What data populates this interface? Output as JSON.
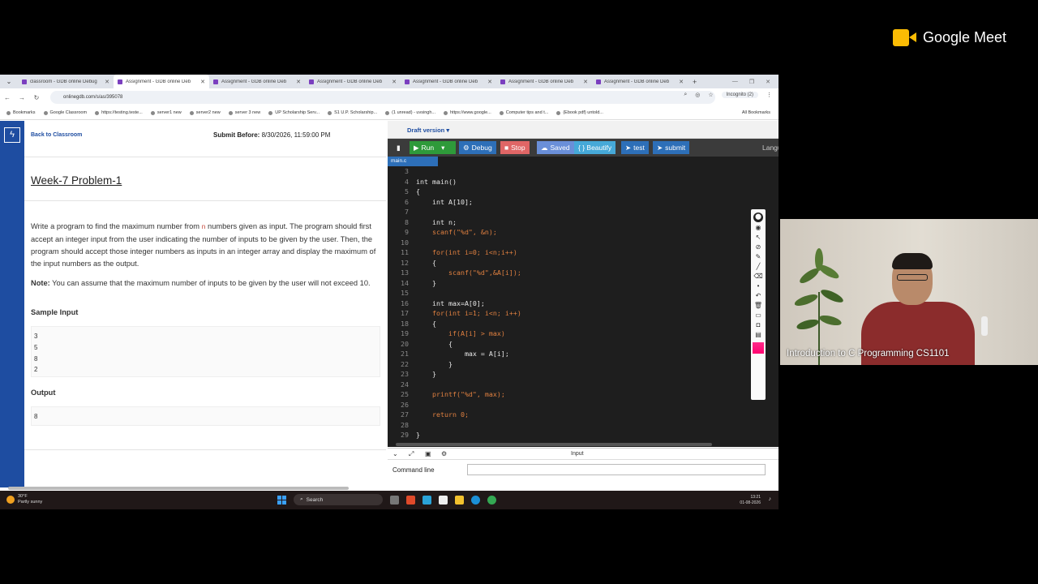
{
  "browser": {
    "tabs": [
      {
        "label": "classroom - GDB online Debug",
        "active": false
      },
      {
        "label": "Assignment - GDB online Deb",
        "active": true
      },
      {
        "label": "Assignment - GDB online Deb",
        "active": false
      },
      {
        "label": "Assignment - GDB online Deb",
        "active": false
      },
      {
        "label": "Assignment - GDB online Deb",
        "active": false
      },
      {
        "label": "Assignment - GDB online Deb",
        "active": false
      },
      {
        "label": "Assignment - GDB online Deb",
        "active": false
      }
    ],
    "url": "onlinegdb.com/s/as/395078",
    "profile": "Incognito (2)",
    "bookmarks": [
      "Bookmarks",
      "Google Classroom",
      "https://testing.teste...",
      "server1 new",
      "server2 new",
      "server 3 new",
      "UP Scholarship Serv...",
      "S1 U.P. Scholarship...",
      "(1 unread) - uvsingh...",
      "https://www.google...",
      "Computer tips and t...",
      "(Ebook pdf) untold..."
    ],
    "all_bookmarks": "All Bookmarks"
  },
  "problem": {
    "back_link": "Back to Classroom",
    "submit_label": "Submit Before:",
    "submit_date": "8/30/2026, 11:59:00 PM",
    "title": "Week-7 Problem-1",
    "desc_1": "Write a program to find the maximum number from ",
    "desc_n": "n",
    "desc_2": " numbers given as input. The program should first accept an integer input from the user indicating the number of inputs to be given by the user. Then, the program should accept those integer numbers as inputs in an integer array and display the maximum of the input numbers as the output.",
    "note_label": "Note:",
    "note_text": " You can assume that the maximum number of inputs to be given by the user will not exceed 10.",
    "sample_input_heading": "Sample Input",
    "sample_input": [
      "3",
      "5",
      "8",
      "2"
    ],
    "output_heading": "Output",
    "output": [
      "8"
    ]
  },
  "editor": {
    "draft": "Draft version ▾",
    "buttons": {
      "run": "Run",
      "debug": "Debug",
      "stop": "Stop",
      "saved": "Saved",
      "beautify": "{ } Beautify",
      "test": "test",
      "submit": "submit",
      "language": "Langu"
    },
    "file_tab": "main.c",
    "lines": [
      {
        "n": "3",
        "t": ""
      },
      {
        "n": "4",
        "t": "int main()"
      },
      {
        "n": "5",
        "t": "{"
      },
      {
        "n": "6",
        "t": "    int A[10];"
      },
      {
        "n": "7",
        "t": ""
      },
      {
        "n": "8",
        "t": "    int n;"
      },
      {
        "n": "9",
        "t": "    scanf(\"%d\", &n);"
      },
      {
        "n": "10",
        "t": ""
      },
      {
        "n": "11",
        "t": "    for(int i=0; i<n;i++)"
      },
      {
        "n": "12",
        "t": "    {"
      },
      {
        "n": "13",
        "t": "        scanf(\"%d\",&A[i]);"
      },
      {
        "n": "14",
        "t": "    }"
      },
      {
        "n": "15",
        "t": ""
      },
      {
        "n": "16",
        "t": "    int max=A[0];"
      },
      {
        "n": "17",
        "t": "    for(int i=1; i<n; i++)"
      },
      {
        "n": "18",
        "t": "    {"
      },
      {
        "n": "19",
        "t": "        if(A[i] > max)"
      },
      {
        "n": "20",
        "t": "        {"
      },
      {
        "n": "21",
        "t": "            max = A[i];"
      },
      {
        "n": "22",
        "t": "        }"
      },
      {
        "n": "23",
        "t": "    }"
      },
      {
        "n": "24",
        "t": ""
      },
      {
        "n": "25",
        "t": "    printf(\"%d\", max);"
      },
      {
        "n": "26",
        "t": ""
      },
      {
        "n": "27",
        "t": "    return 0;"
      },
      {
        "n": "28",
        "t": ""
      },
      {
        "n": "29",
        "t": "}"
      }
    ]
  },
  "input_panel": {
    "title": "Input",
    "cmd_label": "Command line"
  },
  "taskbar": {
    "temp": "30°F",
    "weather": "Partly sunny",
    "search": "Search",
    "time": "13:21",
    "date": "01-08-2026"
  },
  "meet": {
    "brand": "Google Meet",
    "caption": "Introduction to C Programming CS1101"
  },
  "colors": {
    "accent": "#1e4da1",
    "run": "#2e9a3a",
    "debug": "#2d6fb8",
    "stop": "#e06666",
    "saved": "#6a8fd8",
    "beautify": "#46a9d8",
    "meet_yellow": "#fbbc04"
  }
}
